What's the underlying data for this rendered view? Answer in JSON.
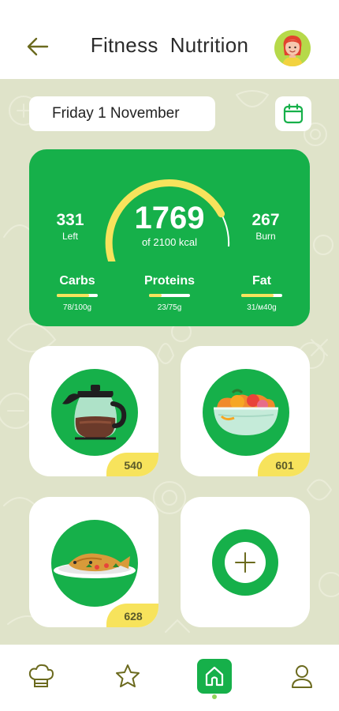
{
  "header": {
    "title": "Fitness  Nutrition",
    "back_icon": "arrow-left-icon",
    "avatar_icon": "user-avatar"
  },
  "date": {
    "label": "Friday 1 November",
    "calendar_icon": "calendar-icon"
  },
  "summary": {
    "consumed": "1769",
    "goal_text": "of 2100 kcal",
    "left_value": "331",
    "left_label": "Left",
    "burn_value": "267",
    "burn_label": "Burn",
    "progress": 0.84,
    "macros": [
      {
        "name": "Carbs",
        "amount": "78/100g",
        "progress": 0.78
      },
      {
        "name": "Proteins",
        "amount": "23/75g",
        "progress": 0.31
      },
      {
        "name": "Fat",
        "amount": "31/м40g",
        "progress": 0.78
      }
    ]
  },
  "meals": [
    {
      "icon": "coffee-pot-icon",
      "kcal": "540"
    },
    {
      "icon": "fruit-bowl-icon",
      "kcal": "601"
    },
    {
      "icon": "fish-dish-icon",
      "kcal": "628"
    }
  ],
  "add_meal": {
    "icon": "plus-icon"
  },
  "nav": {
    "items": [
      "chef-hat-icon",
      "star-icon",
      "home-icon",
      "profile-icon"
    ],
    "active": "home-icon"
  },
  "colors": {
    "accent_green": "#16b04a",
    "accent_yellow": "#f7e35c",
    "background": "#dfe3c9",
    "icon_olive": "#6b6a1e"
  }
}
